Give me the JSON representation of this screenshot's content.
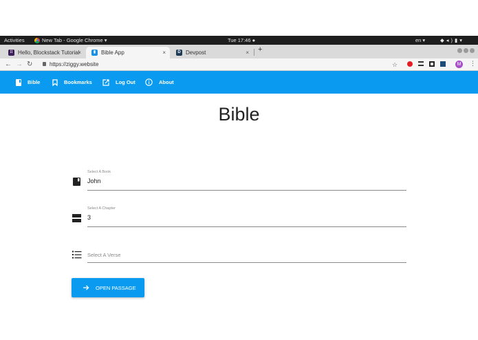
{
  "system": {
    "activities": "Activities",
    "active_app": "New Tab - Google Chrome ▾",
    "clock": "Tue 17:46 ●",
    "language": "en ▾"
  },
  "tabs": [
    {
      "label": "Hello, Blockstack Tutorial",
      "close": "×"
    },
    {
      "label": "Bible App",
      "close": "×"
    },
    {
      "label": "Devpost",
      "close": "×"
    }
  ],
  "new_tab": "+",
  "address": {
    "url": "https://ziggy.website",
    "avatar_initial": "M"
  },
  "nav": {
    "items": [
      {
        "label": "Bible",
        "icon": "book-icon"
      },
      {
        "label": "Bookmarks",
        "icon": "bookmark-icon"
      },
      {
        "label": "Log Out",
        "icon": "logout-icon"
      },
      {
        "label": "About",
        "icon": "info-icon"
      }
    ]
  },
  "page": {
    "title": "Bible",
    "book": {
      "label": "Select A Book",
      "value": "John"
    },
    "chapter": {
      "label": "Select A Chapter",
      "value": "3"
    },
    "verse": {
      "placeholder": "Select A Verse"
    },
    "open_button": "OPEN PASSAGE"
  },
  "colors": {
    "primary": "#0a9bf0",
    "topbar": "#1e1e1e",
    "dock": "#2b2b2b"
  }
}
